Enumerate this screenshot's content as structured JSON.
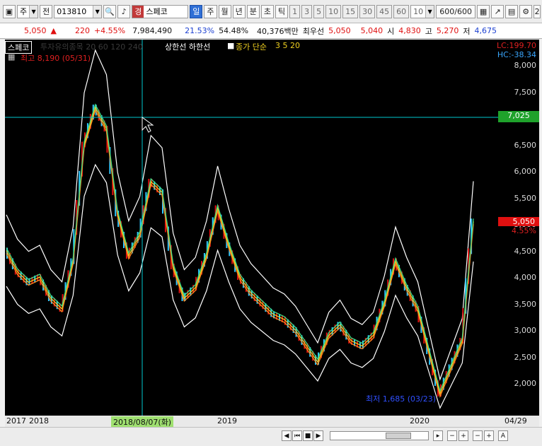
{
  "toolbar": {
    "market_label": "주",
    "jeon_label": "전",
    "code": "013810",
    "name": "스페코",
    "name_badge": "경",
    "periods": [
      "일",
      "주",
      "월",
      "년"
    ],
    "minute": [
      "분",
      "초",
      "틱"
    ],
    "numbers": [
      "1",
      "3",
      "5",
      "10",
      "15",
      "30",
      "45",
      "60",
      "10"
    ],
    "count": "600/600",
    "edge_label": "2"
  },
  "quote": {
    "price": "5,050",
    "change": "220",
    "change_pct": "+4.55%",
    "volume": "7,984,490",
    "turnover": "21.53%",
    "ratio": "54.48%",
    "amount": "40,376백만",
    "priority_label": "최우선",
    "bid1": "5,050",
    "bid2": "5,040",
    "open_label": "시",
    "open": "4,830",
    "high_label": "고",
    "high": "5,270",
    "low_label": "저",
    "low": "4,675"
  },
  "chart_header": {
    "tag": "스페코",
    "faded": "투자유의종목 20 60 120 240",
    "limit_lines": "상한선 하한선",
    "ma_label": "종가 단순",
    "ma_periods": "3  5  20",
    "max_label": "최고 8,190 (05/31)",
    "min_label": "최저 1,685 (03/23)",
    "lc": "LC:199.70",
    "hc": "HC:-38.34"
  },
  "axis": {
    "prices": [
      "8,000",
      "7,500",
      "7,000",
      "6,500",
      "6,000",
      "5,500",
      "5,000",
      "4,500",
      "4,000",
      "3,500",
      "3,000",
      "2,500",
      "2,000"
    ],
    "crosshair_price": "7,025",
    "last_price": "5,050",
    "last_pct": "4.55%",
    "x_labels": [
      "2017",
      "2018",
      "2019",
      "2020"
    ],
    "crosshair_date": "2018/08/07(화)",
    "last_date": "04/29"
  },
  "colors": {
    "up": "#e01010",
    "down": "#1b3fd1",
    "crosshair": "#00c8d0",
    "badge_green": "#1fa22b"
  },
  "chart_data": {
    "type": "line",
    "title": "",
    "series": [
      {
        "name": "종가",
        "values": [
          4500,
          4100,
          3900,
          4000,
          3600,
          3400,
          4300,
          6500,
          7200,
          6800,
          5200,
          4400,
          4800,
          5800,
          5600,
          4200,
          3600,
          3800,
          4400,
          5300,
          4600,
          4000,
          3700,
          3500,
          3300,
          3200,
          3000,
          2700,
          2400,
          2900,
          3100,
          2800,
          2700,
          2900,
          3500,
          4300,
          3800,
          3400,
          2600,
          1800,
          2300,
          2800,
          5050
        ]
      }
    ],
    "ylim": [
      1685,
      8190
    ]
  }
}
